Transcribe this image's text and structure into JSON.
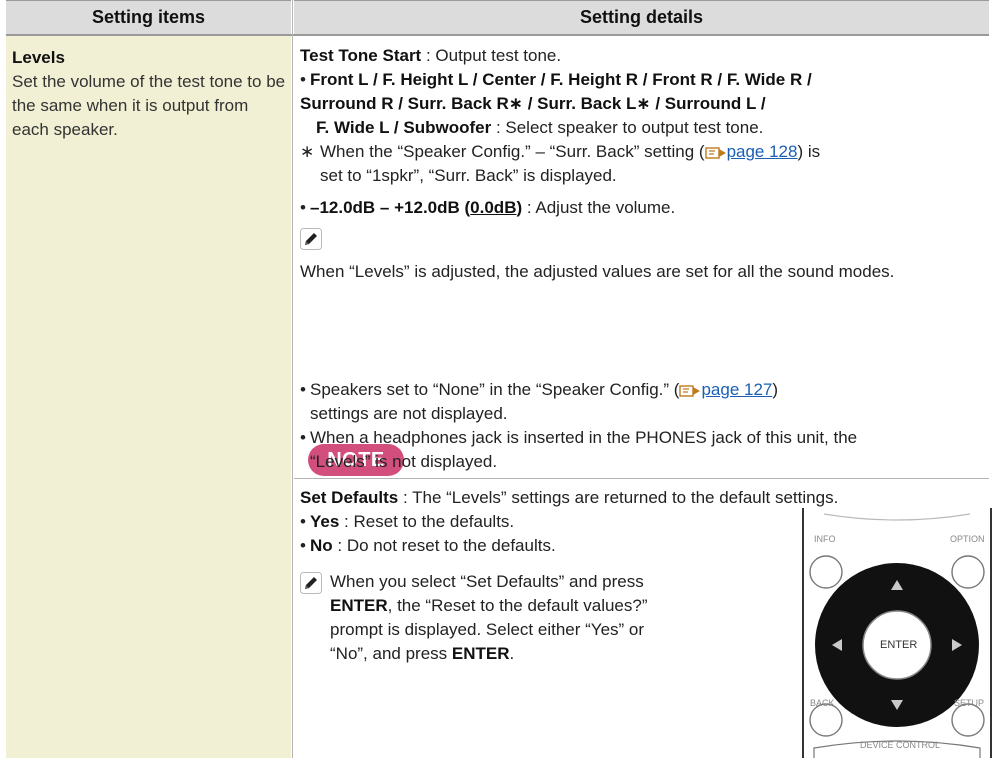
{
  "header": {
    "left": "Setting items",
    "right": "Setting details"
  },
  "left": {
    "title": "Levels",
    "desc": "Set the volume of the test tone to be the same when it is output from each speaker."
  },
  "right": {
    "test_tone_label": "Test Tone Start",
    "test_tone_desc": " : Output test tone.",
    "speakers_line1": "Front L / F. Height L / Center / F. Height R / Front R / F. Wide R /",
    "speakers_line2": "Surround R / Surr. Back R∗ / Surr. Back L∗ / Surround L /",
    "speakers_line3": "F. Wide L / Subwoofer",
    "speakers_desc": " : Select speaker to output test tone.",
    "asterisk": "∗",
    "foot_text1": "When the “Speaker Config.” – “Surr. Back” setting (",
    "foot_link": "page 128",
    "foot_text2": ") is",
    "foot_text3": "set to “1spkr”, “Surr. Back” is displayed.",
    "range_label": "–12.0dB – +12.0dB (",
    "range_default": "0.0dB",
    "range_close": ")",
    "range_desc": " : Adjust the volume.",
    "tip_text": "When “Levels” is adjusted, the adjusted values are set for all the sound modes.",
    "note_label": "NOTE",
    "note1_text": "Speakers set to “None” in the “Speaker Config.” (",
    "note1_link": "page 127",
    "note1_end": ")",
    "note1_line2": "settings are not displayed.",
    "note2_line1": "When a headphones jack is inserted in the PHONES jack of this unit, the",
    "note2_line2": "“Levels” is not displayed.",
    "set_defaults_label": "Set Defaults",
    "set_defaults_desc": " : The “Levels” settings are returned to the default settings.",
    "yes_label": "Yes",
    "yes_desc": " : Reset to the defaults.",
    "no_label": "No",
    "no_desc": " : Do not reset to the defaults.",
    "tip2_line1": "When you select “Set Defaults” and press",
    "tip2_enter1": "ENTER",
    "tip2_line2": ", the “Reset to the default values?”",
    "tip2_line3": "prompt is displayed. Select either “Yes” or",
    "tip2_line4a": "“No”, and press ",
    "tip2_enter2": "ENTER",
    "tip2_line4b": "."
  },
  "remote": {
    "info": "INFO",
    "option": "OPTION",
    "enter": "ENTER",
    "back": "BACK",
    "setup": "SETUP",
    "device_control": "DEVICE CONTROL"
  }
}
